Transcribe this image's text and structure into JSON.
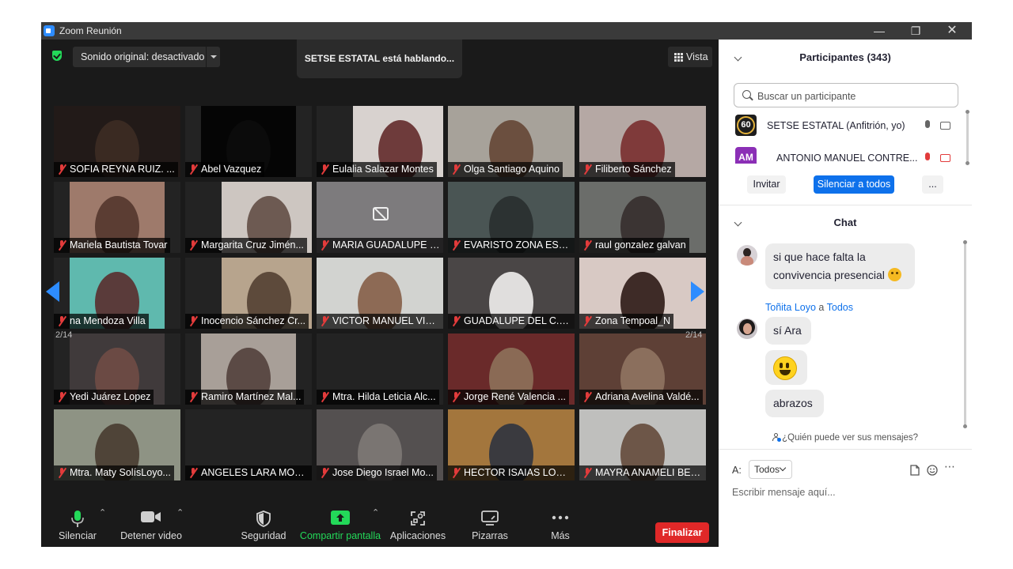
{
  "window": {
    "title": "Zoom Reunión",
    "controls": [
      "minimize",
      "restore",
      "close"
    ]
  },
  "meeting": {
    "sound_label": "Sonido original: desactivado",
    "speaking_banner": "SETSE ESTATAL está hablando...",
    "view_label": "Vista",
    "page_left": "2/14",
    "page_right": "2/14",
    "tiles": [
      {
        "name": "SOFIA  REYNA  RUIZ. ...",
        "bg": "#221a18",
        "fg": "#3a2a22",
        "camoff": false
      },
      {
        "name": "Abel Vazquez",
        "bg": "#050505",
        "fg": "#0b0b0b",
        "camoff": false
      },
      {
        "name": "Eulalia Salazar Montes",
        "bg": "#d8d2cf",
        "fg": "#6e3b3b",
        "camoff": false
      },
      {
        "name": "Olga Santiago Aquino",
        "bg": "#a7a29a",
        "fg": "#6b4f3f",
        "camoff": false
      },
      {
        "name": "Filiberto Sánchez",
        "bg": "#b5a8a4",
        "fg": "#7f3a3a",
        "camoff": false
      },
      {
        "name": "Mariela Bautista Tovar",
        "bg": "#9e7a6b",
        "fg": "#5b3d33",
        "camoff": false
      },
      {
        "name": "Margarita Cruz Jimén...",
        "bg": "#cdc6c1",
        "fg": "#6d5a52",
        "camoff": false
      },
      {
        "name": "MARIA GUADALUPE P...",
        "bg": "#7d7b7d",
        "fg": "#7d7b7d",
        "camoff": true
      },
      {
        "name": "EVARISTO ZONA ESPI...",
        "bg": "#4a5554",
        "fg": "#2c3232",
        "camoff": false
      },
      {
        "name": "raul gonzalez galvan",
        "bg": "#6b6d6a",
        "fg": "#3b3433",
        "camoff": false
      },
      {
        "name": "na Mendoza Villa",
        "bg": "#5fb9ae",
        "fg": "#5a3b3a",
        "camoff": false
      },
      {
        "name": "Inocencio Sánchez Cr...",
        "bg": "#b7a48d",
        "fg": "#5d4a3b",
        "camoff": false
      },
      {
        "name": "VICTOR MANUEL VILL...",
        "bg": "#d2d3d0",
        "fg": "#8d6a55",
        "camoff": false
      },
      {
        "name": "GUADALUPE DEL C. S...",
        "bg": "#4a4646",
        "fg": "#e0dedd",
        "camoff": false
      },
      {
        "name": "Zona Tempoal_N",
        "bg": "#d8c9c4",
        "fg": "#3e2b27",
        "camoff": false
      },
      {
        "name": "Yedi Juárez Lopez",
        "bg": "#403a3b",
        "fg": "#6b4a44",
        "camoff": false
      },
      {
        "name": "Ramiro Martínez Mal...",
        "bg": "#a89f98",
        "fg": "#5b4a45",
        "camoff": false
      },
      {
        "name": "Mtra. Hilda Leticia Alc...",
        "bg": "#232323",
        "fg": "#232323",
        "camoff": false
      },
      {
        "name": "Jorge René Valencia ...",
        "bg": "#6a2a2a",
        "fg": "#8a6a55",
        "camoff": false
      },
      {
        "name": "Adriana Avelina Valdé...",
        "bg": "#5e4036",
        "fg": "#8b6f5d",
        "camoff": false
      },
      {
        "name": "Mtra. Maty SolísLoyo...",
        "bg": "#8e9384",
        "fg": "#4f4438",
        "camoff": false
      },
      {
        "name": "ANGELES LARA MOLI...",
        "bg": "#232323",
        "fg": "#232323",
        "camoff": false
      },
      {
        "name": "Jose Diego Israel Mo...",
        "bg": "#545050",
        "fg": "#7a7572",
        "camoff": false
      },
      {
        "name": "HECTOR ISAIAS LOPE...",
        "bg": "#a3763d",
        "fg": "#3a3a3f",
        "camoff": false
      },
      {
        "name": "MAYRA ANAMELI BEL...",
        "bg": "#bfbfbd",
        "fg": "#6d5648",
        "camoff": false
      }
    ]
  },
  "toolbar": {
    "mute": "Silenciar",
    "video": "Detener video",
    "security": "Seguridad",
    "share": "Compartir pantalla",
    "apps": "Aplicaciones",
    "whiteboards": "Pizarras",
    "more": "Más",
    "end": "Finalizar"
  },
  "participants": {
    "title": "Participantes (343)",
    "search_placeholder": "Buscar un participante",
    "list": [
      {
        "initials": "60",
        "name": "SETSE ESTATAL (Anfitrión, yo)",
        "avatar_color": "#1d1d1d"
      },
      {
        "initials": "AM",
        "name": "ANTONIO MANUEL CONTRE...",
        "avatar_color": "#8b2fb6"
      }
    ],
    "invite": "Invitar",
    "mute_all": "Silenciar a todos",
    "more": "..."
  },
  "chat": {
    "title": "Chat",
    "messages": [
      {
        "text": "si que hace falta la convivencia presencial"
      },
      {
        "sender": "Toñita Loyo",
        "connector": "a",
        "recipient": "Todos"
      },
      {
        "text": "sí Ara"
      },
      {
        "text": "abrazos"
      }
    ],
    "who_can_see": "¿Quién puede ver sus mensajes?",
    "to_label": "A:",
    "to_value": "Todos",
    "input_placeholder": "Escribir mensaje aquí..."
  },
  "colors": {
    "accent": "#0e71eb",
    "end": "#e02828",
    "share": "#23d959",
    "mic": "#23d959",
    "mute": "#e23b3b"
  }
}
